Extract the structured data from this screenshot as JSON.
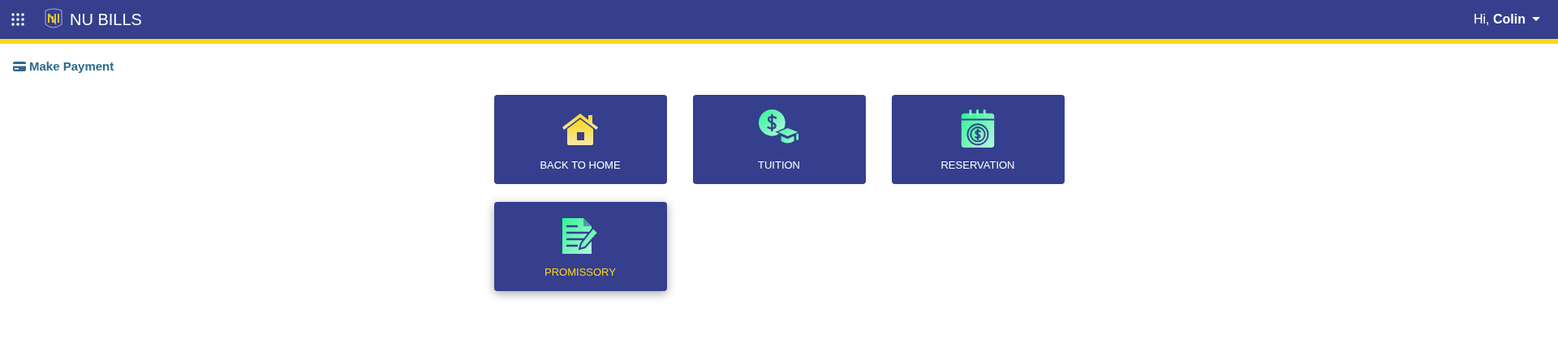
{
  "navbar": {
    "title": "NU BILLS",
    "greeting": "Hi,",
    "user": "Colin"
  },
  "page_title": "Make Payment",
  "tiles": [
    {
      "label": "BACK TO HOME",
      "kind": "home",
      "hovered": false
    },
    {
      "label": "TUITION",
      "kind": "tuition",
      "hovered": false
    },
    {
      "label": "RESERVATION",
      "kind": "reservation",
      "hovered": false
    },
    {
      "label": "PROMISSORY",
      "kind": "promissory",
      "hovered": true
    }
  ]
}
